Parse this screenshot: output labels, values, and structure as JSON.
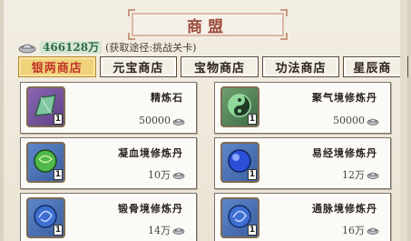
{
  "window": {
    "title": "商盟"
  },
  "currency": {
    "amount": "466128万",
    "hint": "(获取途径:挑战关卡)",
    "icon": "silver-ingot-icon"
  },
  "tabs": [
    {
      "label": "银两商店",
      "active": true
    },
    {
      "label": "元宝商店",
      "active": false
    },
    {
      "label": "宝物商店",
      "active": false
    },
    {
      "label": "功法商店",
      "active": false
    },
    {
      "label": "星辰商",
      "active": false
    }
  ],
  "items": [
    {
      "name": "精炼石",
      "price": "50000",
      "qty": "1",
      "icon": "refine-stone-icon",
      "color": "#6e4f9a"
    },
    {
      "name": "聚气境修炼丹",
      "price": "50000",
      "qty": "1",
      "icon": "yin-yang-pill-icon",
      "color": "#4f7f55"
    },
    {
      "name": "凝血境修炼丹",
      "price": "10万",
      "qty": "1",
      "icon": "green-pill-icon",
      "color": "#4a7fbf"
    },
    {
      "name": "易经境修炼丹",
      "price": "12万",
      "qty": "1",
      "icon": "blue-pill-icon",
      "color": "#4a7fbf"
    },
    {
      "name": "锻骨境修炼丹",
      "price": "14万",
      "qty": "1",
      "icon": "swirl-pill-icon",
      "color": "#4a7fbf"
    },
    {
      "name": "通脉境修炼丹",
      "price": "16万",
      "qty": "1",
      "icon": "swirl-pill-icon",
      "color": "#4a7fbf"
    }
  ]
}
